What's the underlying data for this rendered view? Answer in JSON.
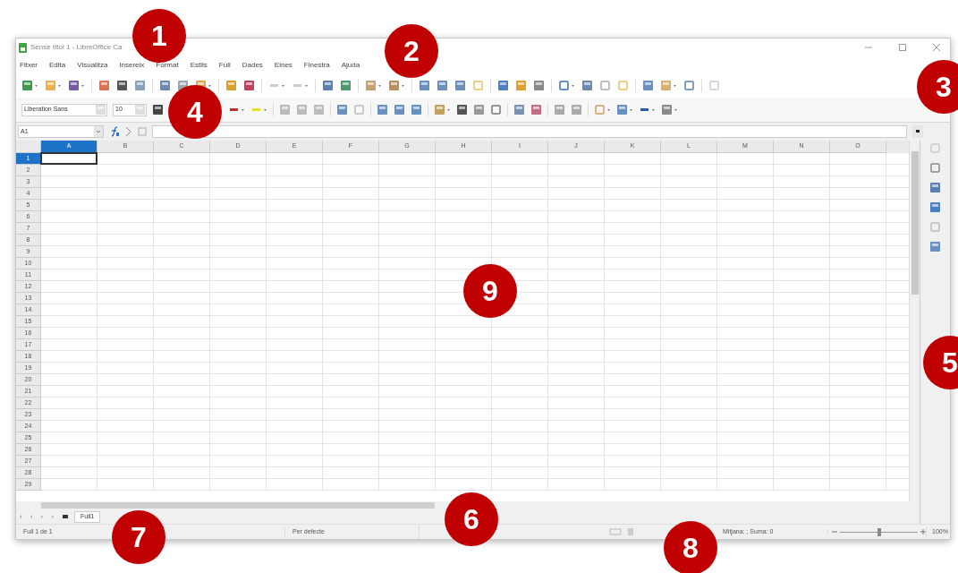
{
  "window": {
    "title": "Sense títol 1 - LibreOffice Ca"
  },
  "menu": [
    "Fitxer",
    "Edita",
    "Visualitza",
    "Insereix",
    "Format",
    "Estils",
    "Full",
    "Dades",
    "Eines",
    "Finestra",
    "Ajuda"
  ],
  "formatting": {
    "font_name": "Liberation Sans",
    "font_size": "10"
  },
  "formula_bar": {
    "name_box": "A1"
  },
  "sheet": {
    "columns": [
      {
        "label": "A",
        "selected": true
      },
      {
        "label": "B",
        "selected": false
      },
      {
        "label": "C",
        "selected": false
      },
      {
        "label": "D",
        "selected": false
      },
      {
        "label": "E",
        "selected": false
      },
      {
        "label": "F",
        "selected": false
      },
      {
        "label": "G",
        "selected": false
      },
      {
        "label": "H",
        "selected": false
      },
      {
        "label": "I",
        "selected": false
      },
      {
        "label": "J",
        "selected": false
      },
      {
        "label": "K",
        "selected": false
      },
      {
        "label": "L",
        "selected": false
      },
      {
        "label": "M",
        "selected": false
      },
      {
        "label": "N",
        "selected": false
      },
      {
        "label": "O",
        "selected": false
      }
    ],
    "rows": [
      {
        "label": "1",
        "selected": true
      },
      {
        "label": "2",
        "selected": false
      },
      {
        "label": "3",
        "selected": false
      },
      {
        "label": "4",
        "selected": false
      },
      {
        "label": "5",
        "selected": false
      },
      {
        "label": "6",
        "selected": false
      },
      {
        "label": "7",
        "selected": false
      },
      {
        "label": "8",
        "selected": false
      },
      {
        "label": "9",
        "selected": false
      },
      {
        "label": "10",
        "selected": false
      },
      {
        "label": "11",
        "selected": false
      },
      {
        "label": "12",
        "selected": false
      },
      {
        "label": "13",
        "selected": false
      },
      {
        "label": "14",
        "selected": false
      },
      {
        "label": "15",
        "selected": false
      },
      {
        "label": "16",
        "selected": false
      },
      {
        "label": "17",
        "selected": false
      },
      {
        "label": "18",
        "selected": false
      },
      {
        "label": "19",
        "selected": false
      },
      {
        "label": "20",
        "selected": false
      },
      {
        "label": "21",
        "selected": false
      },
      {
        "label": "22",
        "selected": false
      },
      {
        "label": "23",
        "selected": false
      },
      {
        "label": "24",
        "selected": false
      },
      {
        "label": "25",
        "selected": false
      },
      {
        "label": "26",
        "selected": false
      },
      {
        "label": "27",
        "selected": false
      },
      {
        "label": "28",
        "selected": false
      },
      {
        "label": "29",
        "selected": false
      }
    ]
  },
  "sheet_tabs": [
    {
      "label": "Full1",
      "selected": true
    }
  ],
  "status_bar": {
    "sheet": "Full 1 de 1",
    "page_style": "Per defecte",
    "summary": "Mitjana: ; Suma: 0",
    "zoom_slider": {
      "level": 0.5
    },
    "zoom": "100%"
  },
  "callouts": [
    "1",
    "2",
    "3",
    "4",
    "5",
    "6",
    "7",
    "8",
    "9"
  ]
}
